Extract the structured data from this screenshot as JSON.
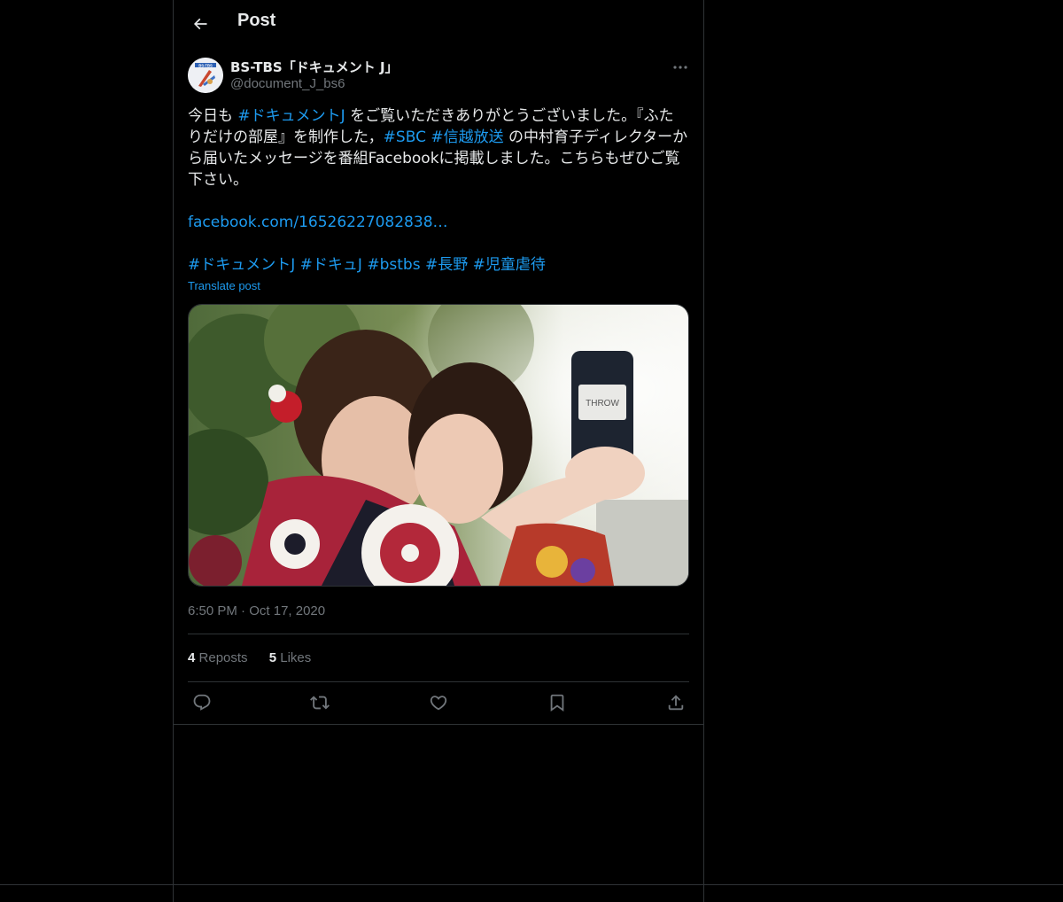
{
  "header": {
    "title": "Post"
  },
  "post": {
    "author": {
      "display_name": "BS-TBS「ドキュメント J」",
      "handle": "@document_J_bs6",
      "avatar_text": "BS-TBS"
    },
    "text_lines": [
      [
        {
          "t": "今日も "
        },
        {
          "t": "#ドキュメントJ",
          "link": true
        },
        {
          "t": " をご覧いただきありがとうございました。『ふた"
        }
      ],
      [
        {
          "t": "りだけの部屋』を制作した，"
        },
        {
          "t": "#SBC",
          "link": true
        },
        {
          "t": " "
        },
        {
          "t": "#信越放送",
          "link": true
        },
        {
          "t": " の中村育子ディレクターか"
        }
      ],
      [
        {
          "t": "ら届いたメッセージを番組Facebookに掲載しました。こちらもぜひご覧"
        }
      ],
      [
        {
          "t": "下さい。"
        }
      ]
    ],
    "link_text": "facebook.com/16526227082838…",
    "hashtags": [
      "#ドキュメントJ",
      "#ドキュJ",
      "#bstbs",
      "#長野",
      "#児童虐待"
    ],
    "translate_label": "Translate post",
    "media_text": "THROW",
    "time": "6:50 PM",
    "date": "Oct 17, 2020",
    "reposts_count": "4",
    "reposts_label": "Reposts",
    "likes_count": "5",
    "likes_label": "Likes"
  },
  "actions": [
    "reply-icon",
    "repost-icon",
    "like-icon",
    "bookmark-icon",
    "share-icon"
  ],
  "colors": {
    "background": "#000000",
    "link": "#1d9bf0",
    "text": "#e7e9ea",
    "secondary": "#71767b",
    "border": "#2f3336"
  }
}
